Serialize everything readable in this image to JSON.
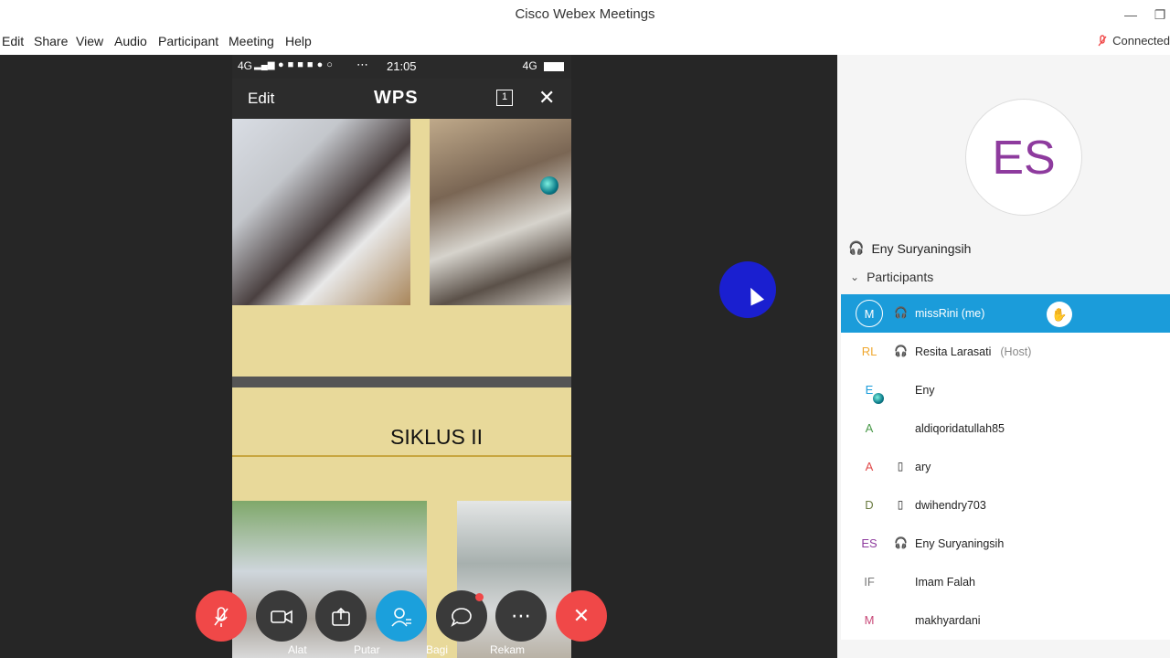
{
  "window": {
    "title": "Cisco Webex Meetings",
    "minimize_icon": "minimize-icon",
    "restore_icon": "restore-icon"
  },
  "menu": [
    "Edit",
    "Share",
    "View",
    "Audio",
    "Participant",
    "Meeting",
    "Help"
  ],
  "connection": {
    "status": "Connected",
    "icon": "mic-off-icon",
    "color": "#f04848"
  },
  "phone": {
    "signal": "4G",
    "time": "21:05",
    "right_signal": "4G",
    "toolbar": {
      "edit": "Edit",
      "logo": "WPS",
      "page": "1"
    },
    "slide_title": "SIKLUS II"
  },
  "controls": {
    "labels": {
      "tools": "Alat",
      "play": "Putar",
      "share": "Bagi",
      "record": "Rekam"
    },
    "colors": {
      "mute": "#f04848",
      "participants": "#1ba0dc",
      "leave": "#f04848"
    }
  },
  "panel": {
    "active_speaker_initials": "ES",
    "active_speaker_name": "Eny Suryaningsih",
    "participants_header": "Participants",
    "participants": [
      {
        "initials": "M",
        "name": "missRini  (me)",
        "role": "",
        "device": "headset",
        "selected": true,
        "color": "#ffffff"
      },
      {
        "initials": "RL",
        "name": "Resita Larasati",
        "role": "(Host)",
        "device": "headset",
        "selected": false,
        "color": "#f0a830"
      },
      {
        "initials": "E",
        "name": "Eny",
        "role": "",
        "device": "",
        "selected": false,
        "color": "#1b9cda"
      },
      {
        "initials": "A",
        "name": "aldiqoridatullah85",
        "role": "",
        "device": "",
        "selected": false,
        "color": "#4a9a4a"
      },
      {
        "initials": "A",
        "name": "ary",
        "role": "",
        "device": "mobile",
        "selected": false,
        "color": "#e04848"
      },
      {
        "initials": "D",
        "name": "dwihendry703",
        "role": "",
        "device": "mobile",
        "selected": false,
        "color": "#6a7a40"
      },
      {
        "initials": "ES",
        "name": "Eny Suryaningsih",
        "role": "",
        "device": "headset",
        "selected": false,
        "color": "#8e3b9e"
      },
      {
        "initials": "IF",
        "name": "Imam Falah",
        "role": "",
        "device": "",
        "selected": false,
        "color": "#777777"
      },
      {
        "initials": "M",
        "name": "makhyardani",
        "role": "",
        "device": "",
        "selected": false,
        "color": "#c84878"
      }
    ]
  }
}
